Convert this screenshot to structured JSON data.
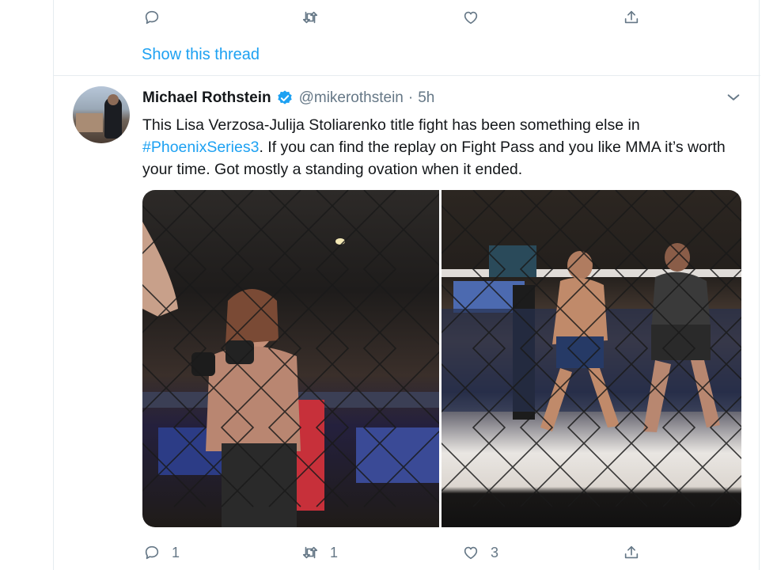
{
  "top_actions": {
    "reply_count": "",
    "retweet_count": "",
    "like_count": ""
  },
  "show_thread": "Show this thread",
  "tweet": {
    "author_name": "Michael Rothstein",
    "handle": "@mikerothstein",
    "separator": "·",
    "time": "5h",
    "text_before": "This Lisa Verzosa-Julija Stoliarenko title fight has been something else in ",
    "hashtag": "#PhoenixSeries3",
    "text_after": ". If you can find the replay on Fight Pass and you like MMA it’s worth your time. Got mostly a standing ovation when it ended.",
    "reply_count": "1",
    "retweet_count": "1",
    "like_count": "3"
  },
  "colors": {
    "accent": "#1da1f2",
    "secondary_text": "#657786",
    "divider": "#e6ecf0"
  },
  "icons": [
    "reply-icon",
    "retweet-icon",
    "like-icon",
    "share-icon",
    "verified-icon",
    "chevron-down-icon"
  ]
}
